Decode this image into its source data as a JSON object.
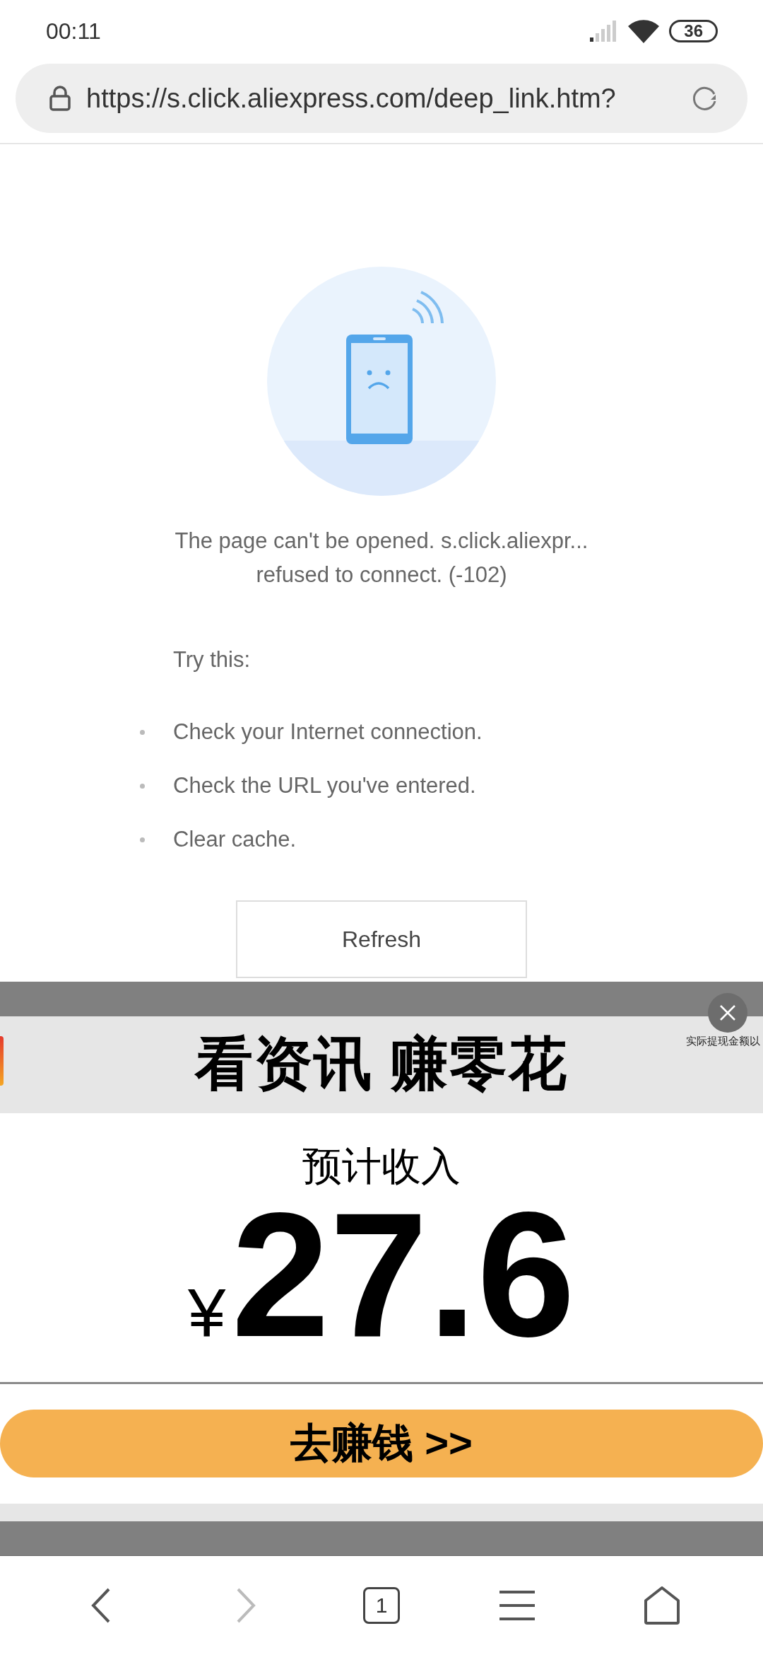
{
  "status_bar": {
    "time": "00:11",
    "battery": "36"
  },
  "address_bar": {
    "url": "https://s.click.aliexpress.com/deep_link.htm?"
  },
  "error": {
    "message": "The page can't be opened. s.click.aliexpr... refused to connect. (-102)",
    "tips_heading": "Try this:",
    "tips": [
      "Check your Internet connection.",
      "Check the URL you've entered.",
      "Clear cache."
    ],
    "refresh_button": "Refresh"
  },
  "ad": {
    "headline": "看资讯 赚零花",
    "note": "实际提现金额以",
    "income_label": "预计收入",
    "currency": "¥",
    "amount": "27.6",
    "cta": "去赚钱 >>"
  },
  "bottom_nav": {
    "tab_count": "1",
    "back_disabled": false,
    "forward_disabled": true
  }
}
